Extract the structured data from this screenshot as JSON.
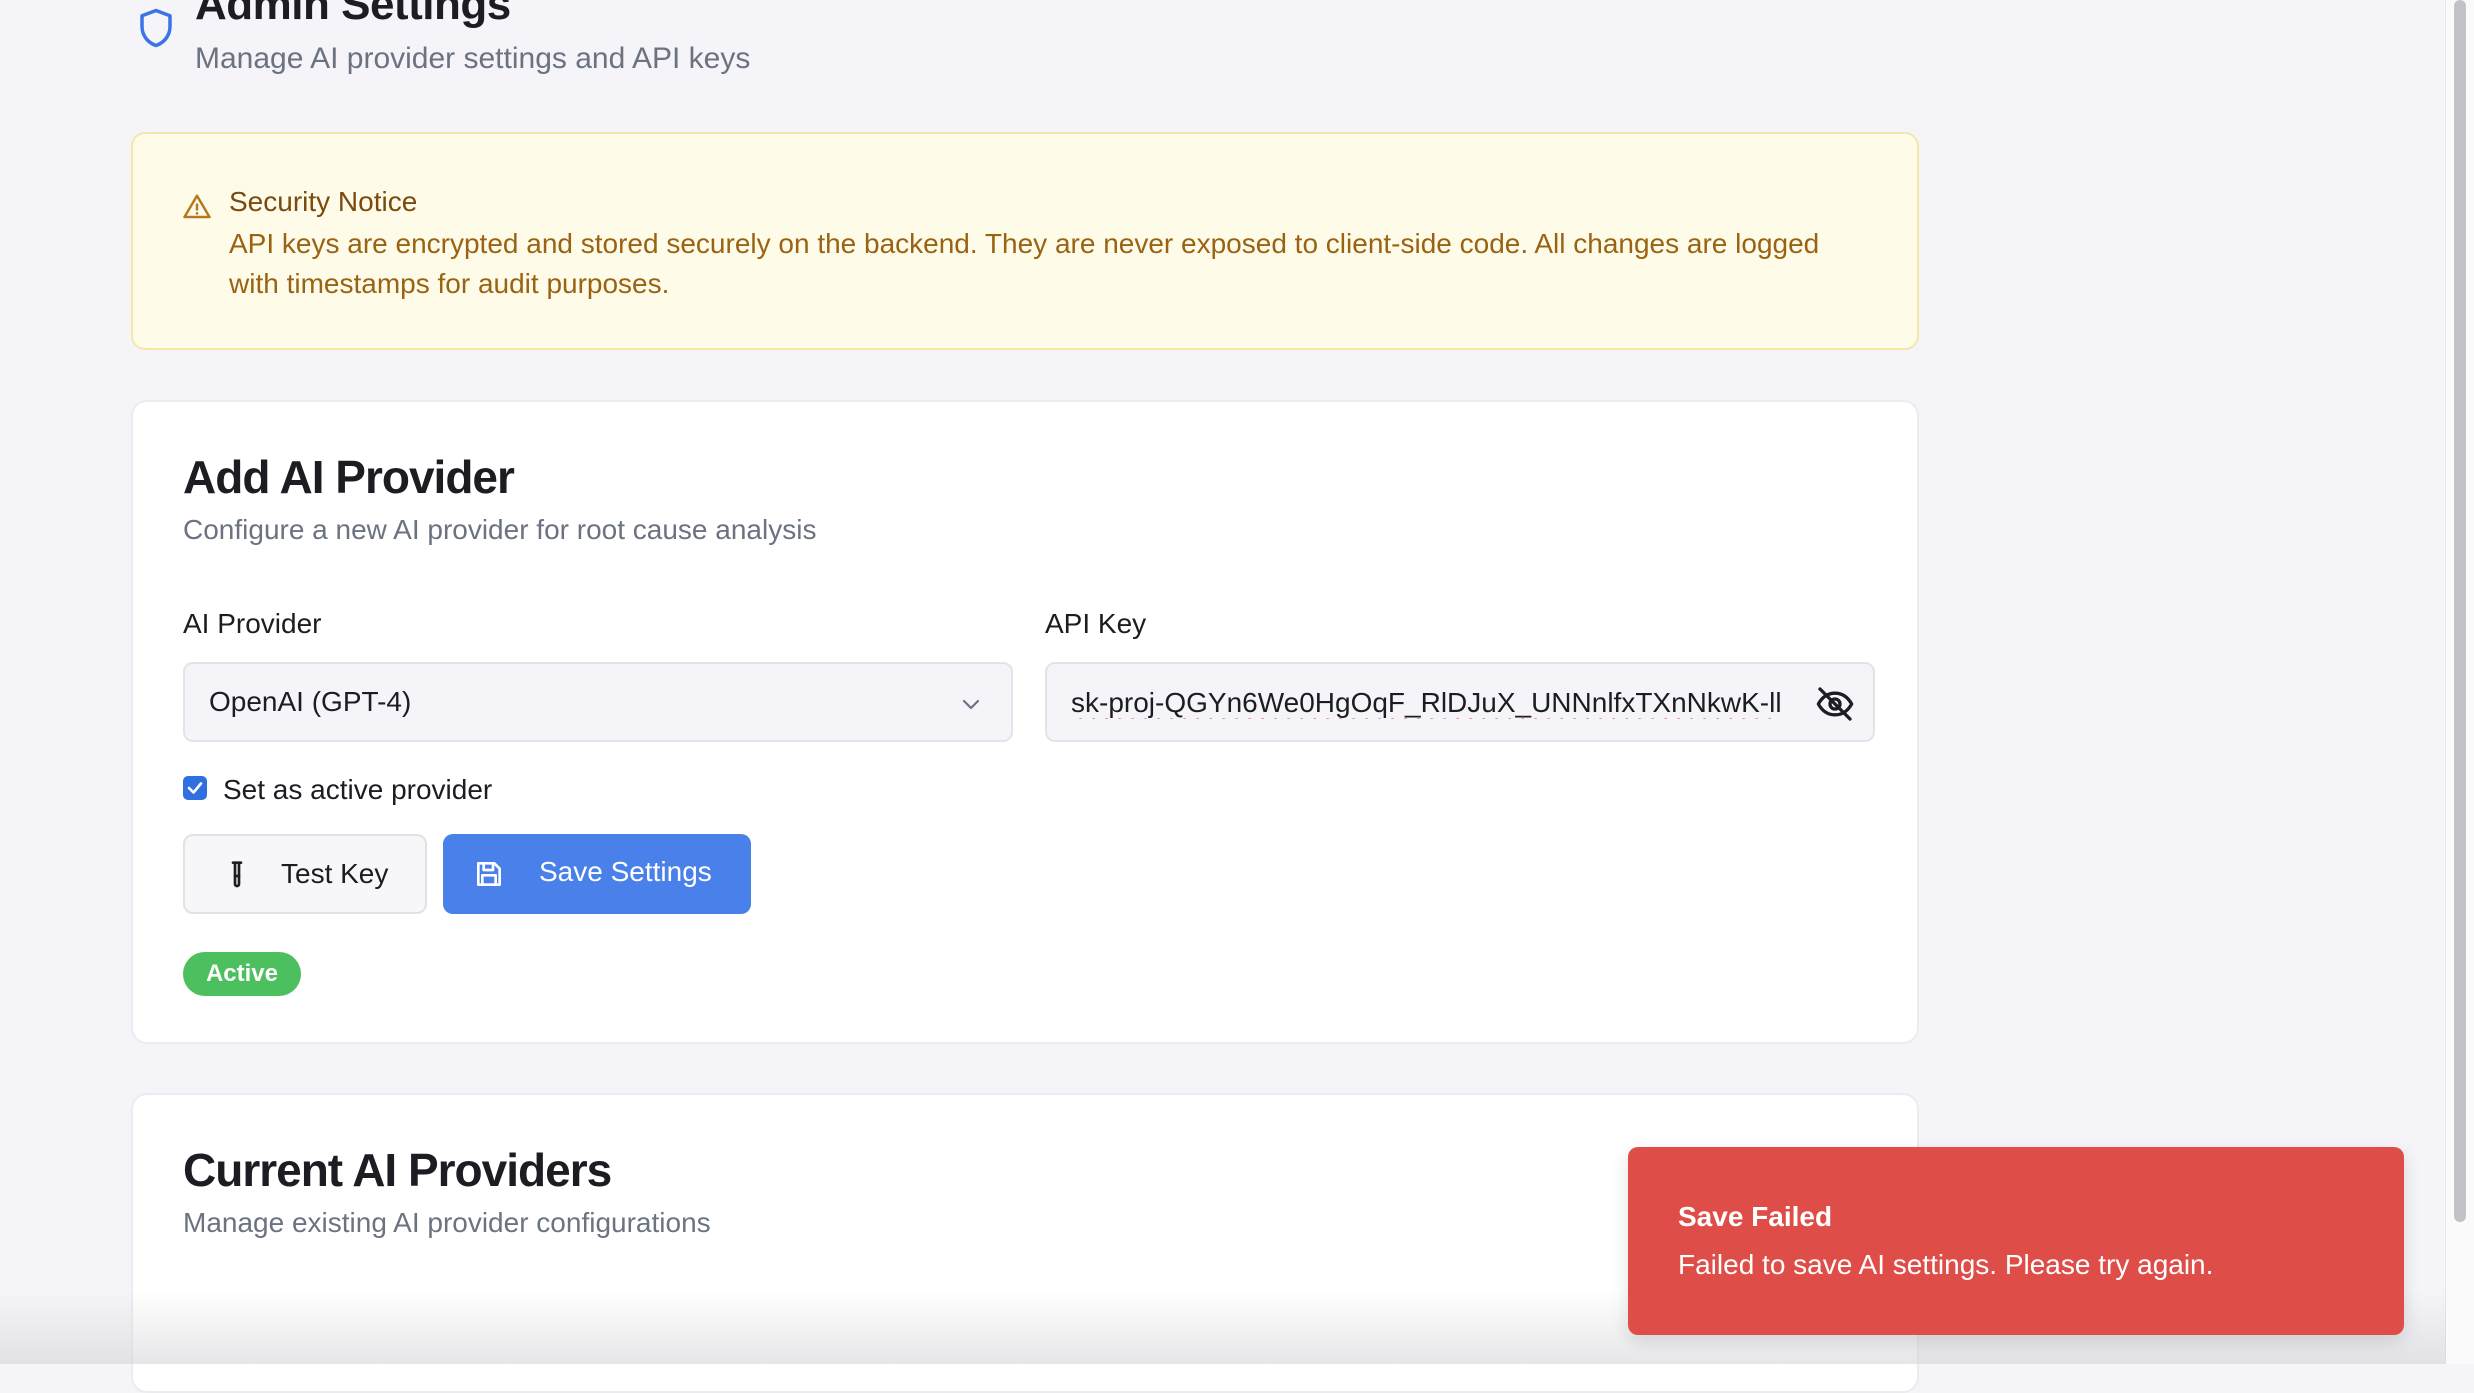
{
  "header": {
    "title": "Admin Settings",
    "subtitle": "Manage AI provider settings and API keys"
  },
  "notice": {
    "title": "Security Notice",
    "text": "API keys are encrypted and stored securely on the backend. They are never exposed to client-side code. All changes are logged with timestamps for audit purposes."
  },
  "add_provider": {
    "title": "Add AI Provider",
    "description": "Configure a new AI provider for root cause analysis",
    "provider_label": "AI Provider",
    "provider_value": "OpenAI (GPT-4)",
    "api_key_label": "API Key",
    "api_key_value": "sk-proj-QGYn6We0HgOqF_RlDJuX_UNNnlfxTXnNkwK-ll",
    "active_checkbox_label": "Set as active provider",
    "active_checked": true,
    "test_button_label": "Test Key",
    "save_button_label": "Save Settings",
    "status_badge": "Active"
  },
  "current_providers": {
    "title": "Current AI Providers",
    "description": "Manage existing AI provider configurations"
  },
  "toast": {
    "title": "Save Failed",
    "message": "Failed to save AI settings. Please try again."
  },
  "colors": {
    "accent": "#4a80ea",
    "success": "#4cbf5e",
    "error": "#de4d48",
    "warning_bg": "#fefce8",
    "warning_text": "#9a6314"
  },
  "icons": {
    "header": "shield-icon",
    "notice": "warning-triangle-icon",
    "select": "chevron-down-icon",
    "api_key_toggle": "eye-off-icon",
    "test_button": "test-tube-icon",
    "save_button": "save-icon"
  }
}
